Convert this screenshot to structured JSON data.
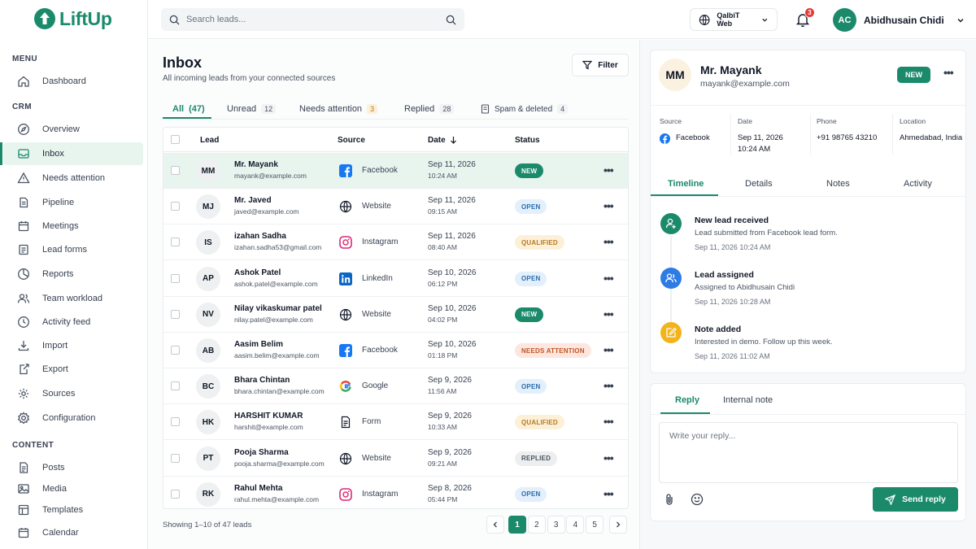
{
  "brand": {
    "name": "LiftUp",
    "color": "#1b8a6b"
  },
  "sidebar": {
    "menu_label": "MENU",
    "crm_label": "CRM",
    "content_label": "CONTENT",
    "menu_items": [
      {
        "label": "Dashboard",
        "icon": "home-icon"
      }
    ],
    "crm_items": [
      {
        "label": "Overview",
        "icon": "compass-icon"
      },
      {
        "label": "Inbox",
        "icon": "inbox-icon",
        "active": true
      },
      {
        "label": "Needs attention",
        "icon": "alert-icon"
      },
      {
        "label": "Pipeline",
        "icon": "pipeline-icon"
      },
      {
        "label": "Meetings",
        "icon": "calendar-icon"
      },
      {
        "label": "Lead forms",
        "icon": "form-icon"
      },
      {
        "label": "Reports",
        "icon": "chart-icon"
      },
      {
        "label": "Team workload",
        "icon": "team-icon"
      },
      {
        "label": "Activity feed",
        "icon": "clock-icon"
      },
      {
        "label": "Import",
        "icon": "download-icon"
      },
      {
        "label": "Export",
        "icon": "export-icon"
      },
      {
        "label": "Sources",
        "icon": "sources-icon"
      },
      {
        "label": "Configuration",
        "icon": "gear-icon"
      }
    ],
    "content_items": [
      {
        "label": "Posts",
        "icon": "document-icon"
      },
      {
        "label": "Media",
        "icon": "image-icon"
      },
      {
        "label": "Templates",
        "icon": "template-icon"
      },
      {
        "label": "Calendar",
        "icon": "calendar-icon"
      }
    ]
  },
  "topbar": {
    "search_placeholder": "Search leads...",
    "workspace": "QalbiT Web",
    "notifications": "3",
    "user_initials": "AC",
    "user_name": "Abidhusain Chidi"
  },
  "inbox": {
    "title": "Inbox",
    "subtitle": "All incoming leads from your connected sources",
    "filter_label": "Filter",
    "tabs": [
      {
        "label": "All",
        "count": "(47)"
      },
      {
        "label": "Unread",
        "count": "12"
      },
      {
        "label": "Needs attention",
        "count": "3"
      },
      {
        "label": "Replied",
        "count": "28"
      },
      {
        "label": "Spam & deleted",
        "count": "4"
      }
    ],
    "columns": {
      "lead": "Lead",
      "source": "Source",
      "date": "Date",
      "status": "Status"
    },
    "rows": [
      {
        "initials": "MM",
        "name": "Mr. Mayank",
        "email": "mayank@example.com",
        "source": "Facebook",
        "source_icon": "facebook-icon",
        "date": "Sep 11, 2026",
        "time": "10:24 AM",
        "status": "NEW",
        "status_kind": "new"
      },
      {
        "initials": "MJ",
        "name": "Mr. Javed",
        "email": "javed@example.com",
        "source": "Website",
        "source_icon": "globe-icon",
        "date": "Sep 11, 2026",
        "time": "09:15 AM",
        "status": "OPEN",
        "status_kind": "open"
      },
      {
        "initials": "IS",
        "name": "izahan Sadha",
        "email": "izahan.sadha53@gmail.com",
        "source": "Instagram",
        "source_icon": "instagram-icon",
        "date": "Sep 11, 2026",
        "time": "08:40 AM",
        "status": "QUALIFIED",
        "status_kind": "qualified"
      },
      {
        "initials": "AP",
        "name": "Ashok Patel",
        "email": "ashok.patel@example.com",
        "source": "LinkedIn",
        "source_icon": "linkedin-icon",
        "date": "Sep 10, 2026",
        "time": "06:12 PM",
        "status": "OPEN",
        "status_kind": "open"
      },
      {
        "initials": "NV",
        "name": "Nilay vikaskumar patel",
        "email": "nilay.patel@example.com",
        "source": "Website",
        "source_icon": "globe-icon",
        "date": "Sep 10, 2026",
        "time": "04:02 PM",
        "status": "NEW",
        "status_kind": "new"
      },
      {
        "initials": "AB",
        "name": "Aasim Belim",
        "email": "aasim.belim@example.com",
        "source": "Facebook",
        "source_icon": "facebook-icon",
        "date": "Sep 10, 2026",
        "time": "01:18 PM",
        "status": "NEEDS ATTENTION",
        "status_kind": "attn"
      },
      {
        "initials": "BC",
        "name": "Bhara Chintan",
        "email": "bhara.chintan@example.com",
        "source": "Google",
        "source_icon": "google-icon",
        "date": "Sep 9, 2026",
        "time": "11:56 AM",
        "status": "OPEN",
        "status_kind": "open"
      },
      {
        "initials": "HK",
        "name": "HARSHIT KUMAR",
        "email": "harshit@example.com",
        "source": "Form",
        "source_icon": "form-icon",
        "date": "Sep 9, 2026",
        "time": "10:33 AM",
        "status": "QUALIFIED",
        "status_kind": "qualified"
      },
      {
        "initials": "PT",
        "name": "Pooja Sharma",
        "email": "pooja.sharma@example.com",
        "source": "Website",
        "source_icon": "globe-icon",
        "date": "Sep 9, 2026",
        "time": "09:21 AM",
        "status": "REPLIED",
        "status_kind": "replied"
      },
      {
        "initials": "RK",
        "name": "Rahul Mehta",
        "email": "rahul.mehta@example.com",
        "source": "Instagram",
        "source_icon": "instagram-icon",
        "date": "Sep 8, 2026",
        "time": "05:44 PM",
        "status": "OPEN",
        "status_kind": "open"
      }
    ],
    "showing": "Showing 1–10 of 47 leads",
    "pages": [
      "1",
      "2",
      "3",
      "4",
      "5"
    ],
    "current_page": "1"
  },
  "detail": {
    "initials": "MM",
    "name": "Mr. Mayank",
    "email": "mayank@example.com",
    "status": "NEW",
    "source_label": "Source",
    "source": "Facebook",
    "date_label": "Date",
    "date": "Sep 11, 2026",
    "time": "10:24 AM",
    "phone_label": "Phone",
    "phone": "+91 98765 43210",
    "location_label": "Location",
    "location": "Ahmedabad, India",
    "tabs": [
      "Timeline",
      "Details",
      "Notes",
      "Activity"
    ],
    "timeline": [
      {
        "title": "New lead received",
        "desc": "Lead submitted from Facebook lead form.",
        "time": "Sep 11, 2026 10:24 AM",
        "icon": "user-plus-icon",
        "color": "#1b8a6b"
      },
      {
        "title": "Lead assigned",
        "desc": "Assigned to Abidhusain Chidi",
        "time": "Sep 11, 2026 10:28 AM",
        "icon": "users-icon",
        "color": "#2f7be5"
      },
      {
        "title": "Note added",
        "desc": "Interested in demo. Follow up this week.",
        "time": "Sep 11, 2026 11:02 AM",
        "icon": "note-icon",
        "color": "#f2b31b"
      }
    ]
  },
  "reply": {
    "tabs": [
      "Reply",
      "Internal note"
    ],
    "placeholder": "Write your reply...",
    "send_label": "Send reply"
  }
}
